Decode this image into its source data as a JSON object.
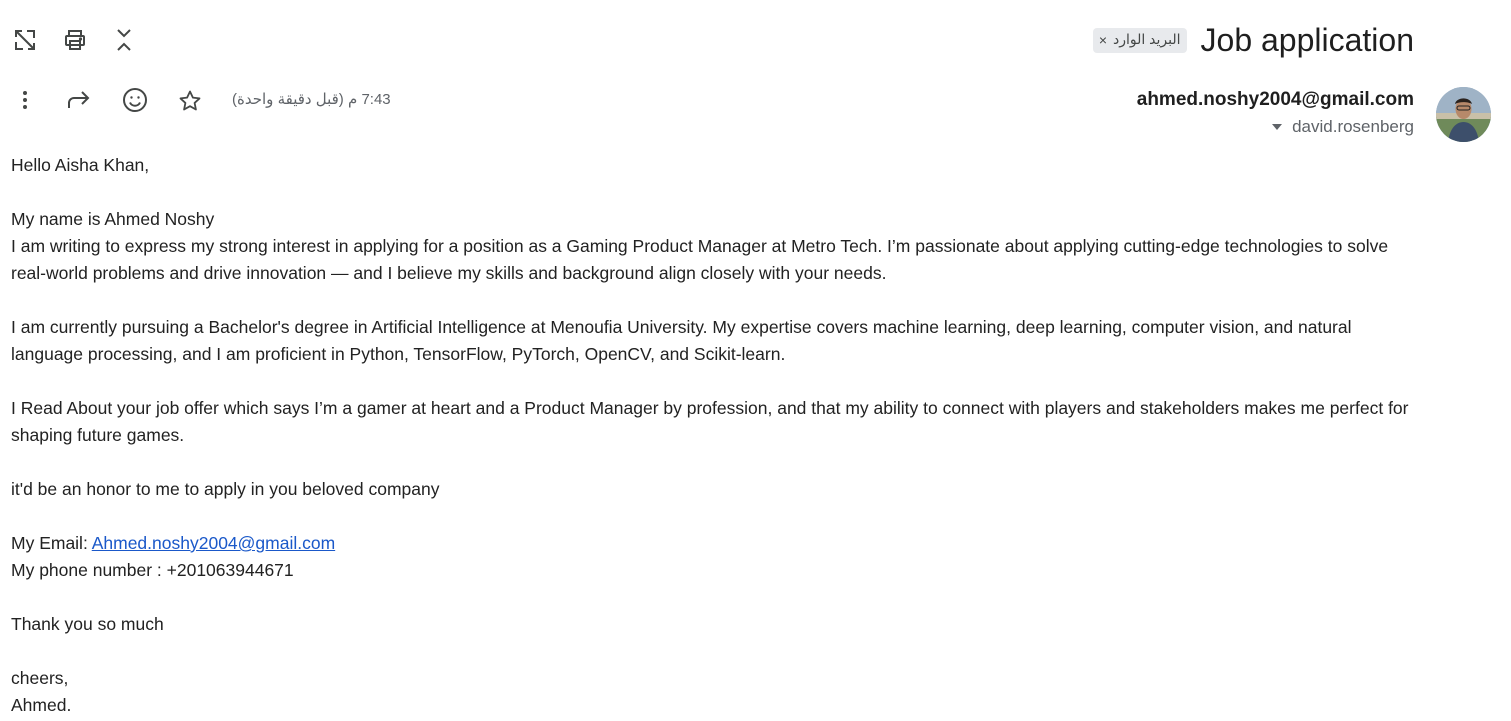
{
  "toolbar": {
    "open_new_window_icon": "open-in-new-window-icon",
    "print_icon": "printer-icon",
    "collapse_icon": "collapse-all-icon"
  },
  "header": {
    "subject": "Job application",
    "label_chip": "البريد الوارد",
    "label_chip_close": "×"
  },
  "message_meta": {
    "time": "7:43 م (قبل دقيقة واحدة)",
    "sender_email": "ahmed.noshy2004@gmail.com",
    "recipient": "david.rosenberg",
    "actions": [
      "more-icon",
      "forward-icon",
      "emoji-reaction-icon",
      "star-icon"
    ]
  },
  "body": {
    "greeting": "Hello Aisha Khan,",
    "line_name": "My name is Ahmed Noshy",
    "para_interest": "I am writing to express my strong interest in applying for a position as a Gaming Product Manager at Metro Tech. I’m passionate about applying cutting-edge technologies to solve real-world problems and drive innovation — and I believe my skills and background align closely with your needs.",
    "para_education": "I am currently pursuing a Bachelor's degree in Artificial Intelligence at Menoufia University. My expertise covers machine learning, deep learning, computer vision, and natural language processing, and I am proficient in Python, TensorFlow, PyTorch, OpenCV, and Scikit-learn.",
    "para_offer": "I Read About your job offer which says I’m a gamer at heart and a Product Manager by profession, and that my ability to connect with players and stakeholders makes me perfect for shaping future games.",
    "line_honor": "it'd be an honor to me to apply in you beloved company",
    "email_label": "My Email: ",
    "email_link": "Ahmed.noshy2004@gmail.com",
    "phone_line": "My phone number : +201063944671",
    "thanks": "Thank you so much",
    "signoff": "cheers,",
    "signature": "Ahmed."
  }
}
